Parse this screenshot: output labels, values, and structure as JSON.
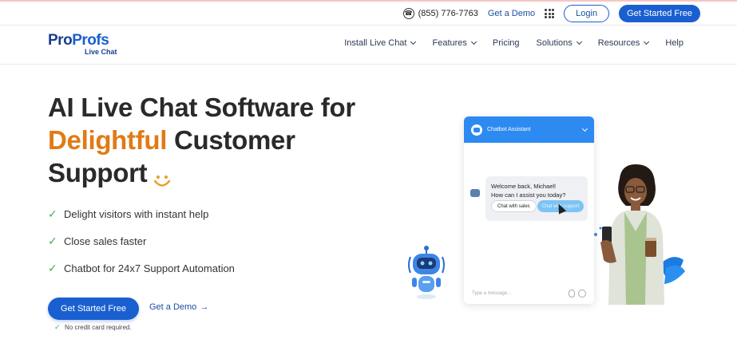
{
  "utility": {
    "phone": "(855) 776-7763",
    "demo": "Get a Demo",
    "login": "Login",
    "get_started": "Get Started Free"
  },
  "logo": {
    "brand_part1": "Pro",
    "brand_part2": "Profs",
    "product": "Live Chat"
  },
  "nav": {
    "items": [
      {
        "label": "Install Live Chat",
        "dropdown": true
      },
      {
        "label": "Features",
        "dropdown": true
      },
      {
        "label": "Pricing",
        "dropdown": false
      },
      {
        "label": "Solutions",
        "dropdown": true
      },
      {
        "label": "Resources",
        "dropdown": true
      },
      {
        "label": "Help",
        "dropdown": false
      }
    ]
  },
  "hero": {
    "line1": "AI Live Chat Software for",
    "highlight": "Delightful",
    "line2_rest": " Customer",
    "line3": "Support",
    "features": [
      "Delight visitors with instant help",
      "Close sales faster",
      "Chatbot for 24x7 Support Automation"
    ],
    "cta_primary": "Get Started Free",
    "cta_demo": "Get a Demo",
    "note": "No credit card required."
  },
  "chat_widget": {
    "title": "Chatbot Assistant",
    "greeting_line1": "Welcome back, Michael!",
    "greeting_line2": "How can I assist you today?",
    "quick_reply_1": "Chat with sales",
    "quick_reply_2": "Chat with support",
    "input_placeholder": "Type a message..."
  },
  "colors": {
    "primary": "#1a5fd0",
    "accent": "#e17a15",
    "heading": "#2a2a2a",
    "check": "#3fae5a",
    "chat_header": "#2d8af0"
  }
}
